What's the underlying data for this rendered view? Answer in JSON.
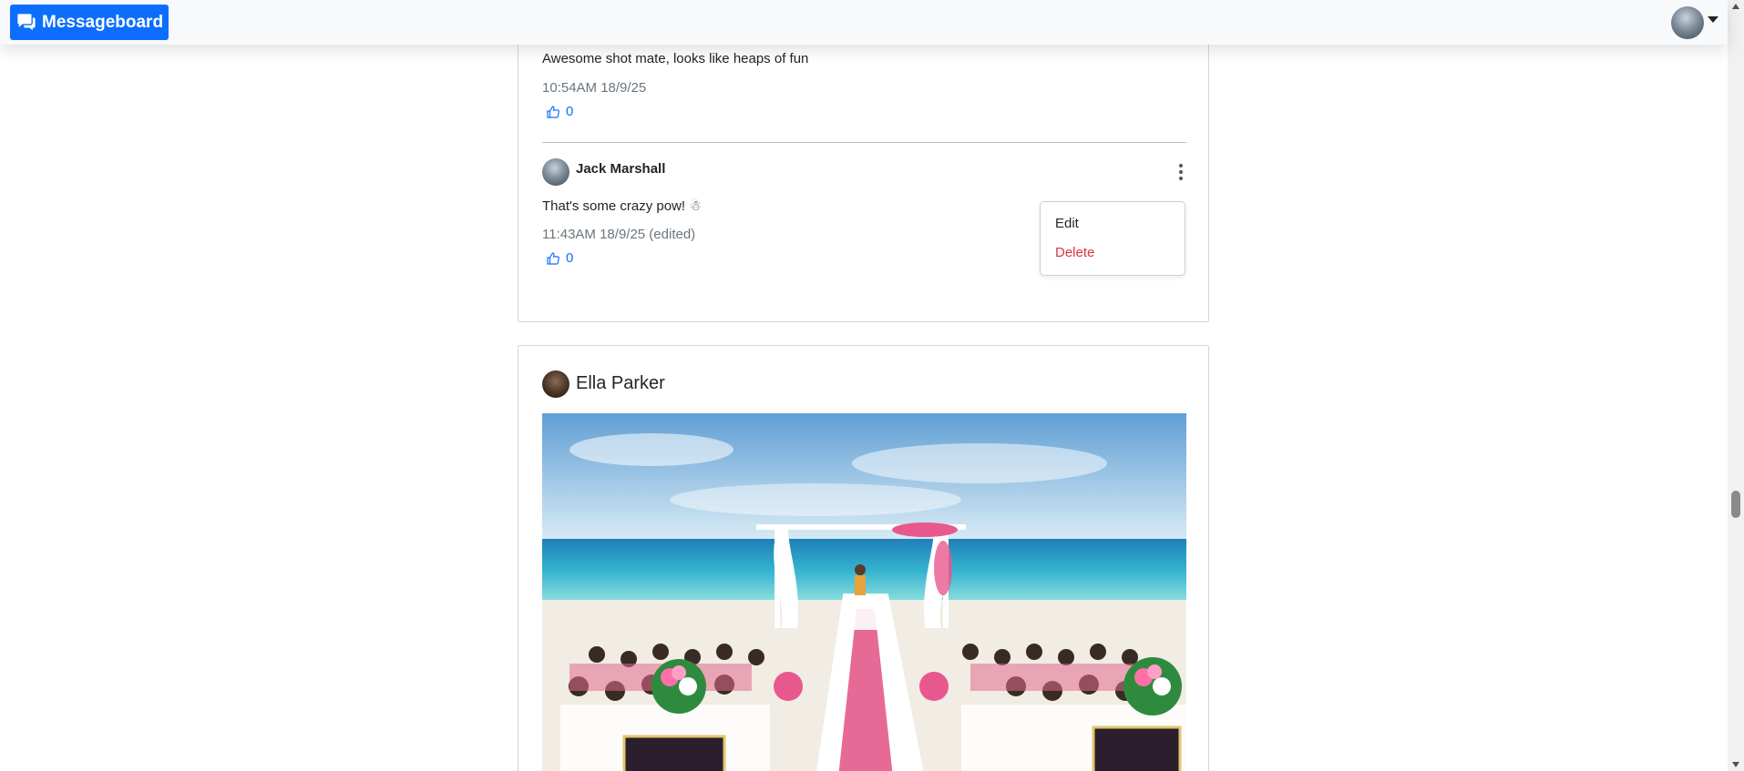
{
  "navbar": {
    "brand_label": "Messageboard",
    "brand_color": "#0d6efd"
  },
  "post_1": {
    "comment_1": {
      "text": "Awesome shot mate, looks like heaps of fun",
      "timestamp": "10:54AM 18/9/25",
      "likes": "0"
    },
    "comment_2": {
      "author": "Jack Marshall",
      "text": "That's some crazy pow! ☃",
      "timestamp": "11:43AM 18/9/25 (edited)",
      "likes": "0"
    },
    "menu": {
      "edit_label": "Edit",
      "delete_label": "Delete"
    }
  },
  "post_2": {
    "author": "Ella Parker"
  },
  "icons": [
    "chat-bubbles-icon",
    "caret-down-icon",
    "thumbs-up-icon",
    "kebab-menu-icon"
  ],
  "colors": {
    "accent": "#0d6efd",
    "danger": "#dc3545",
    "muted": "#6c757d"
  }
}
